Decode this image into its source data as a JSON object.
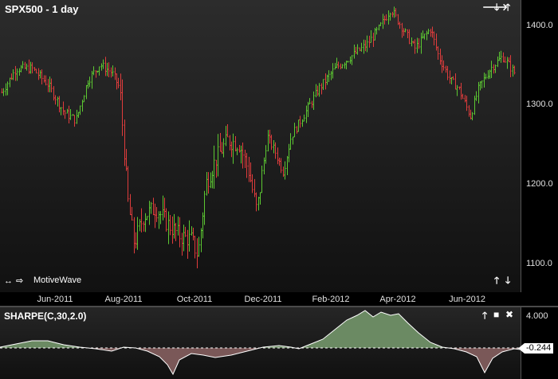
{
  "chart_title": "SPX500 - 1 day",
  "indicator_title": "SHARPE(C,30,2.0)",
  "brand_label": "MotiveWave",
  "price_axis": {
    "ticks": [
      {
        "label": "1400.0",
        "value": 1400
      },
      {
        "label": "1300.0",
        "value": 1300
      },
      {
        "label": "1200.0",
        "value": 1200
      },
      {
        "label": "1100.0",
        "value": 1100
      }
    ]
  },
  "time_axis": {
    "labels": [
      "Jun-2011",
      "Aug-2011",
      "Oct-2011",
      "Dec-2011",
      "Feb-2012",
      "Apr-2012",
      "Jun-2012"
    ]
  },
  "indicator_axis": {
    "top_label": "4.000",
    "current_value": "-0.244"
  },
  "controls": {
    "main": [
      "arrow-right-icon",
      "arrow-down-icon",
      "arrow-up-icon"
    ],
    "indicator": [
      "arrow-up-icon",
      "minimize-icon",
      "close-icon"
    ]
  },
  "colors": {
    "up_bar": "#5cc832",
    "down_bar": "#e03c3c",
    "sharpe_positive": "#6b8a63",
    "sharpe_negative": "#7a5858"
  },
  "chart_data": {
    "type": "ohlc",
    "symbol": "SPX500",
    "interval": "1 day",
    "price_range": [
      1065,
      1435
    ],
    "approx_closes_by_month": [
      {
        "x": "Jun-2011",
        "close": 1320
      },
      {
        "x": "Jul-2011",
        "close": 1340
      },
      {
        "x": "Aug-2011",
        "close": 1190
      },
      {
        "x": "Sep-2011",
        "close": 1160
      },
      {
        "x": "Oct-2011",
        "close": 1250
      },
      {
        "x": "Nov-2011",
        "close": 1230
      },
      {
        "x": "Dec-2011",
        "close": 1255
      },
      {
        "x": "Jan-2012",
        "close": 1310
      },
      {
        "x": "Feb-2012",
        "close": 1365
      },
      {
        "x": "Mar-2012",
        "close": 1405
      },
      {
        "x": "Apr-2012",
        "close": 1400
      },
      {
        "x": "May-2012",
        "close": 1315
      },
      {
        "x": "Jun-2012",
        "close": 1360
      }
    ],
    "indicator": {
      "name": "SHARPE(C,30,2.0)",
      "last_value": -0.244,
      "axis_max": 4.0
    }
  }
}
